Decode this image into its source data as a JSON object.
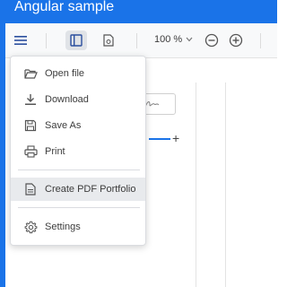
{
  "app": {
    "title": "Angular sample"
  },
  "toolbar": {
    "zoom_value": "100 %",
    "buttons": [
      "menu-icon",
      "panel-icon",
      "file-icon",
      "zoom-out-icon",
      "zoom-in-icon"
    ]
  },
  "menu": {
    "items": [
      {
        "label": "Open file",
        "icon": "folder-open-icon"
      },
      {
        "label": "Download",
        "icon": "download-icon"
      },
      {
        "label": "Save As",
        "icon": "save-icon"
      },
      {
        "label": "Print",
        "icon": "print-icon"
      },
      {
        "label": "Create PDF Portfolio",
        "icon": "file-text-icon",
        "highlighted": true
      },
      {
        "label": "Settings",
        "icon": "gear-icon"
      }
    ]
  },
  "colors": {
    "accent": "#1a73e8",
    "menu_highlight": "#e8eaed"
  }
}
